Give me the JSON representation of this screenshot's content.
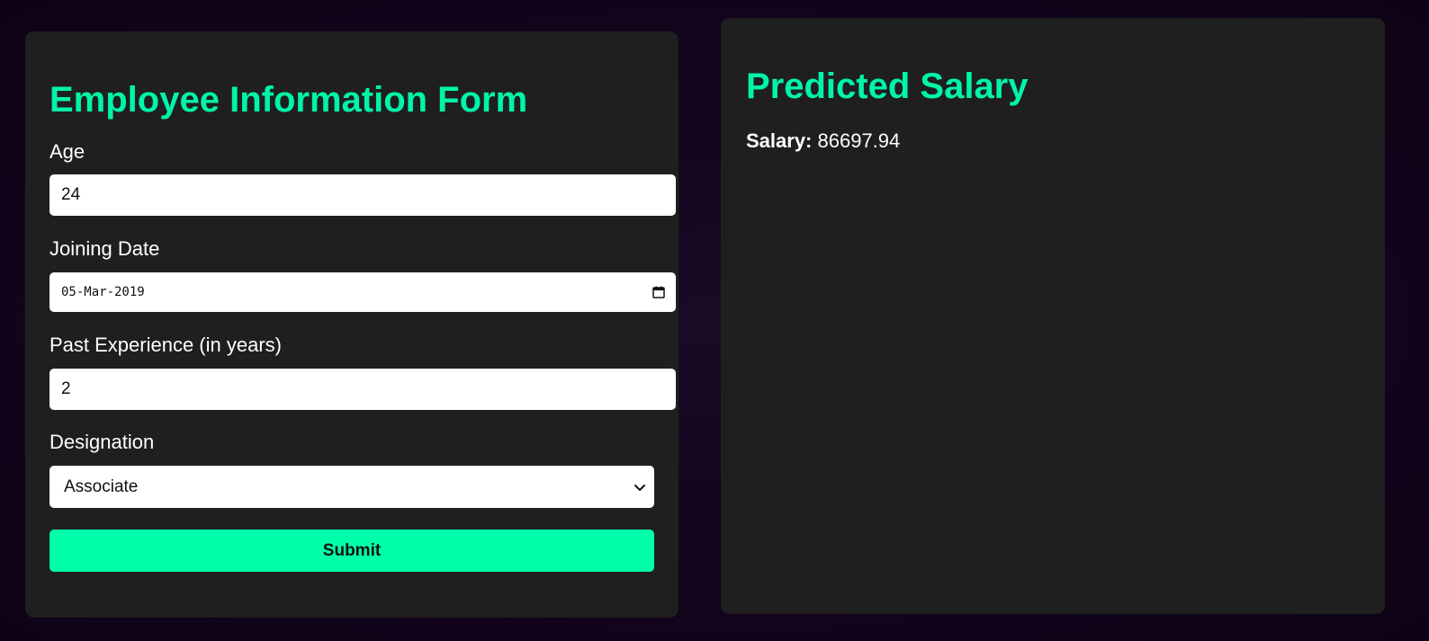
{
  "form": {
    "title": "Employee Information Form",
    "age_label": "Age",
    "age_value": "24",
    "joining_date_label": "Joining Date",
    "joining_date_value": "05-Mar-2019",
    "experience_label": "Past Experience (in years)",
    "experience_value": "2",
    "designation_label": "Designation",
    "designation_selected": "Associate",
    "submit_label": "Submit"
  },
  "result": {
    "title": "Predicted Salary",
    "salary_label": "Salary:",
    "salary_value": "86697.94"
  },
  "icons": {
    "calendar": "calendar-icon",
    "dropdown": "chevron-down-icon"
  },
  "colors": {
    "accent": "#00f5a8",
    "button": "#00ffaa",
    "panel": "#1f1f1f",
    "background": "#12041c"
  }
}
